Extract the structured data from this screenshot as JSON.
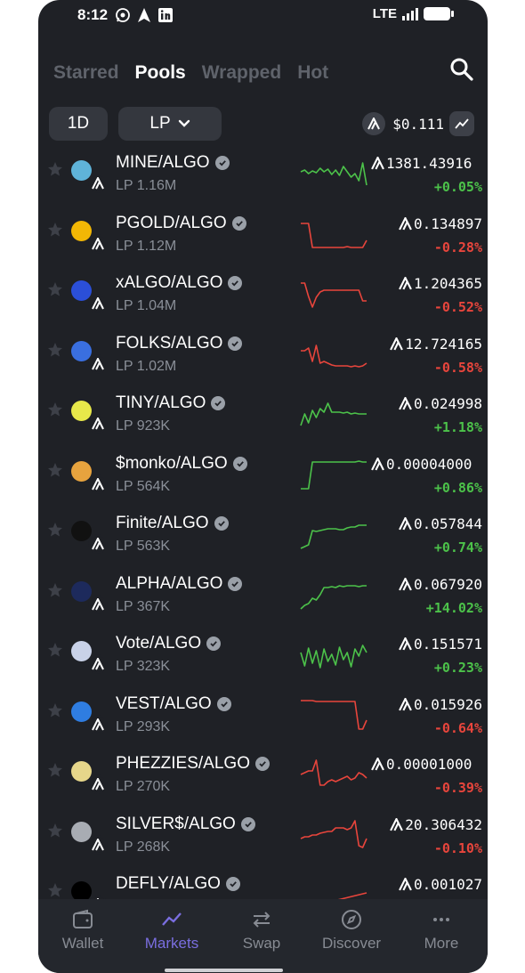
{
  "status": {
    "time": "8:12",
    "network": "LTE"
  },
  "tabs": [
    {
      "label": "Starred",
      "active": false
    },
    {
      "label": "Pools",
      "active": true
    },
    {
      "label": "Wrapped",
      "active": false
    },
    {
      "label": "Hot",
      "active": false
    }
  ],
  "filters": {
    "period": "1D",
    "sort": "LP",
    "algo_price": "$0.111"
  },
  "colors": {
    "up": "#4cc24a",
    "down": "#e8453c",
    "accent": "#7a6ee0"
  },
  "pools": [
    {
      "pair": "MINE/ALGO",
      "lp": "LP 1.16M",
      "price": "1381.43916",
      "change": "+0.05%",
      "trend": "up",
      "icon": "mine-token-icon",
      "spark": [
        20,
        22,
        18,
        21,
        19,
        24,
        20,
        23,
        17,
        22,
        16,
        26,
        20,
        14,
        18,
        10,
        30,
        5
      ]
    },
    {
      "pair": "PGOLD/ALGO",
      "lp": "LP 1.12M",
      "price": "0.134897",
      "change": "-0.28%",
      "trend": "down",
      "icon": "pgold-token-icon",
      "spark": [
        30,
        30,
        30,
        3,
        3,
        3,
        3,
        3,
        3,
        3,
        3,
        3,
        4,
        3,
        3,
        3,
        3,
        11
      ]
    },
    {
      "pair": "xALGO/ALGO",
      "lp": "LP 1.04M",
      "price": "1.204365",
      "change": "-0.52%",
      "trend": "down",
      "icon": "xalgo-token-icon",
      "spark": [
        30,
        30,
        15,
        3,
        14,
        20,
        22,
        22,
        22,
        22,
        22,
        22,
        22,
        22,
        22,
        22,
        10,
        10
      ]
    },
    {
      "pair": "FOLKS/ALGO",
      "lp": "LP 1.02M",
      "price": "12.724165",
      "change": "-0.58%",
      "trend": "down",
      "icon": "folks-token-icon",
      "spark": [
        22,
        22,
        25,
        10,
        28,
        8,
        10,
        8,
        6,
        5,
        5,
        5,
        5,
        4,
        5,
        4,
        5,
        8
      ]
    },
    {
      "pair": "TINY/ALGO",
      "lp": "LP 923K",
      "price": "0.024998",
      "change": "+1.18%",
      "trend": "up",
      "icon": "tiny-token-icon",
      "spark": [
        5,
        18,
        8,
        22,
        14,
        24,
        20,
        30,
        20,
        20,
        20,
        19,
        20,
        18,
        19,
        18,
        18,
        18
      ]
    },
    {
      "pair": "$monko/ALGO",
      "lp": "LP 564K",
      "price": "0.00004000",
      "change": "+0.86%",
      "trend": "up",
      "icon": "monko-token-icon",
      "spark": [
        2,
        2,
        2,
        32,
        32,
        32,
        32,
        32,
        32,
        32,
        32,
        32,
        32,
        32,
        32,
        33,
        32,
        32
      ]
    },
    {
      "pair": "Finite/ALGO",
      "lp": "LP 563K",
      "price": "0.057844",
      "change": "+0.74%",
      "trend": "up",
      "icon": "finite-token-icon",
      "spark": [
        2,
        4,
        6,
        22,
        21,
        22,
        23,
        24,
        24,
        24,
        23,
        23,
        25,
        26,
        26,
        28,
        28,
        28
      ]
    },
    {
      "pair": "ALPHA/ALGO",
      "lp": "LP 367K",
      "price": "0.067920",
      "change": "+14.02%",
      "trend": "up",
      "icon": "alpha-token-icon",
      "spark": [
        2,
        6,
        8,
        14,
        12,
        18,
        26,
        26,
        27,
        26,
        28,
        27,
        28,
        28,
        28,
        27,
        28,
        28
      ]
    },
    {
      "pair": "Vote/ALGO",
      "lp": "LP 323K",
      "price": "0.151571",
      "change": "+0.23%",
      "trend": "up",
      "icon": "vote-token-icon",
      "spark": [
        20,
        5,
        25,
        8,
        22,
        3,
        24,
        10,
        18,
        6,
        26,
        12,
        20,
        4,
        24,
        16,
        28,
        20
      ]
    },
    {
      "pair": "VEST/ALGO",
      "lp": "LP 293K",
      "price": "0.015926",
      "change": "-0.64%",
      "trend": "down",
      "icon": "vest-token-icon",
      "spark": [
        34,
        34,
        34,
        34,
        33,
        33,
        33,
        33,
        33,
        33,
        33,
        33,
        33,
        33,
        33,
        2,
        2,
        12
      ]
    },
    {
      "pair": "PHEZZIES/ALGO",
      "lp": "LP 270K",
      "price": "0.00001000",
      "change": "-0.39%",
      "trend": "down",
      "icon": "phezzies-token-icon",
      "spark": [
        18,
        20,
        22,
        22,
        34,
        6,
        6,
        10,
        12,
        10,
        12,
        14,
        16,
        12,
        14,
        20,
        18,
        14
      ]
    },
    {
      "pair": "SILVER$/ALGO",
      "lp": "LP 268K",
      "price": "20.306432",
      "change": "-0.10%",
      "trend": "down",
      "icon": "silver-token-icon",
      "spark": [
        14,
        16,
        16,
        18,
        18,
        20,
        21,
        22,
        22,
        26,
        26,
        26,
        24,
        26,
        34,
        6,
        4,
        14
      ]
    },
    {
      "pair": "DEFLY/ALGO",
      "lp": "",
      "price": "0.001027",
      "change": "",
      "trend": "down",
      "icon": "defly-token-icon",
      "spark": [
        2,
        20
      ]
    }
  ],
  "nav": [
    {
      "label": "Wallet",
      "icon": "wallet-icon",
      "active": false
    },
    {
      "label": "Markets",
      "icon": "markets-icon",
      "active": true
    },
    {
      "label": "Swap",
      "icon": "swap-icon",
      "active": false
    },
    {
      "label": "Discover",
      "icon": "compass-icon",
      "active": false
    },
    {
      "label": "More",
      "icon": "more-icon",
      "active": false
    }
  ]
}
